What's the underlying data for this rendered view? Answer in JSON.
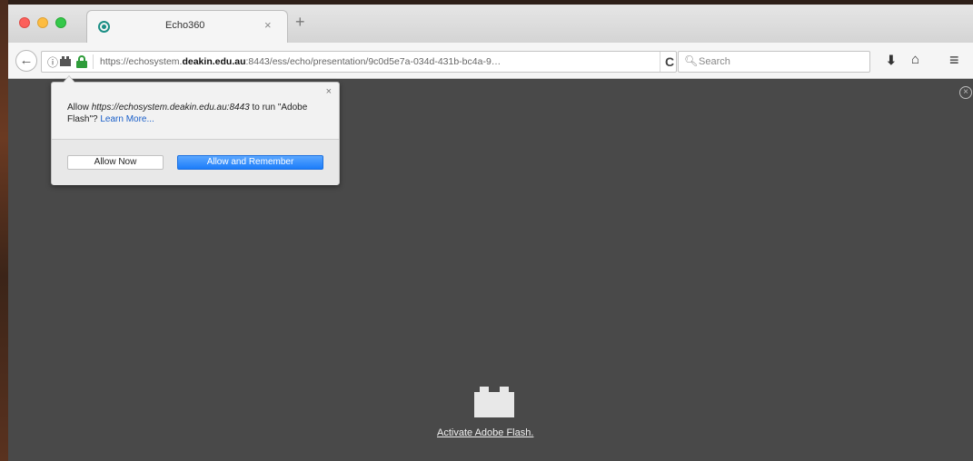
{
  "tab": {
    "title": "Echo360",
    "close_glyph": "×",
    "new_tab_glyph": "+",
    "icon": "echo360-favicon-icon"
  },
  "nav": {
    "back_glyph": "←",
    "url_prefix": "https://echosystem.",
    "url_domain": "deakin.edu.au",
    "url_suffix": ":8443/ess/echo/presentation/9c0d5e7a-034d-431b-bc4a-9…",
    "reload_glyph": "C",
    "search_placeholder": "Search",
    "icons": [
      "info-icon",
      "plugin-icon",
      "lock-icon",
      "search-icon",
      "download-icon",
      "home-icon",
      "menu-icon"
    ]
  },
  "popup": {
    "message_prefix": "Allow ",
    "message_site": "https://echosystem.deakin.edu.au:8443",
    "message_mid": " to run \"Adobe Flash\"? ",
    "learn_more": "Learn More...",
    "close_glyph": "×",
    "allow_now": "Allow Now",
    "allow_remember": "Allow and Remember"
  },
  "content": {
    "close_glyph": "×",
    "activate_link": "Activate Adobe Flash."
  },
  "colors": {
    "content_bg": "#494949",
    "primary_button": "#1c7dfa",
    "lock": "#2e9c3a"
  }
}
